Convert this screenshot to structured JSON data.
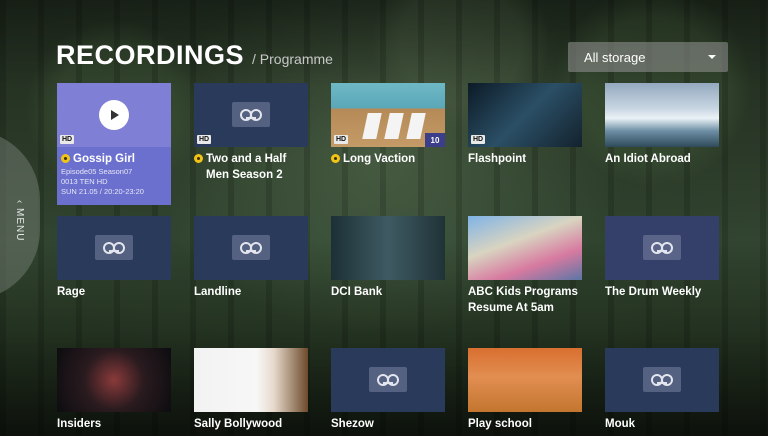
{
  "header": {
    "title": "RECORDINGS",
    "subtitle": "/ Programme"
  },
  "storage": {
    "selected": "All storage"
  },
  "side_menu": {
    "label": "MENU"
  },
  "recordings": [
    {
      "title": "Gossip Girl",
      "badge": "HD",
      "series": true,
      "selected": true,
      "episode": "Episode05 Season07",
      "channel": "0013 TEN HD",
      "time": "SUN 21.05 / 20:20-23:20"
    },
    {
      "title": "Two and a Half Men Season 2",
      "badge": "HD",
      "series": true
    },
    {
      "title": "Long Vaction",
      "badge": "HD",
      "series": true,
      "episode_count": "10"
    },
    {
      "title": "Flashpoint",
      "badge": "HD"
    },
    {
      "title": "An Idiot Abroad"
    },
    {
      "title": "Rage"
    },
    {
      "title": "Landline"
    },
    {
      "title": "DCI Bank"
    },
    {
      "title": "ABC Kids Programs Resume At 5am"
    },
    {
      "title": "The Drum Weekly"
    },
    {
      "title": "Insiders"
    },
    {
      "title": "Sally Bollywood"
    },
    {
      "title": "Shezow"
    },
    {
      "title": "Play school"
    },
    {
      "title": "Mouk"
    }
  ],
  "icons": {
    "play": "play-icon",
    "recording": "recording-icon",
    "series": "series-icon",
    "dropdown": "chevron-down-icon",
    "menu": "chevron-left-icon"
  }
}
